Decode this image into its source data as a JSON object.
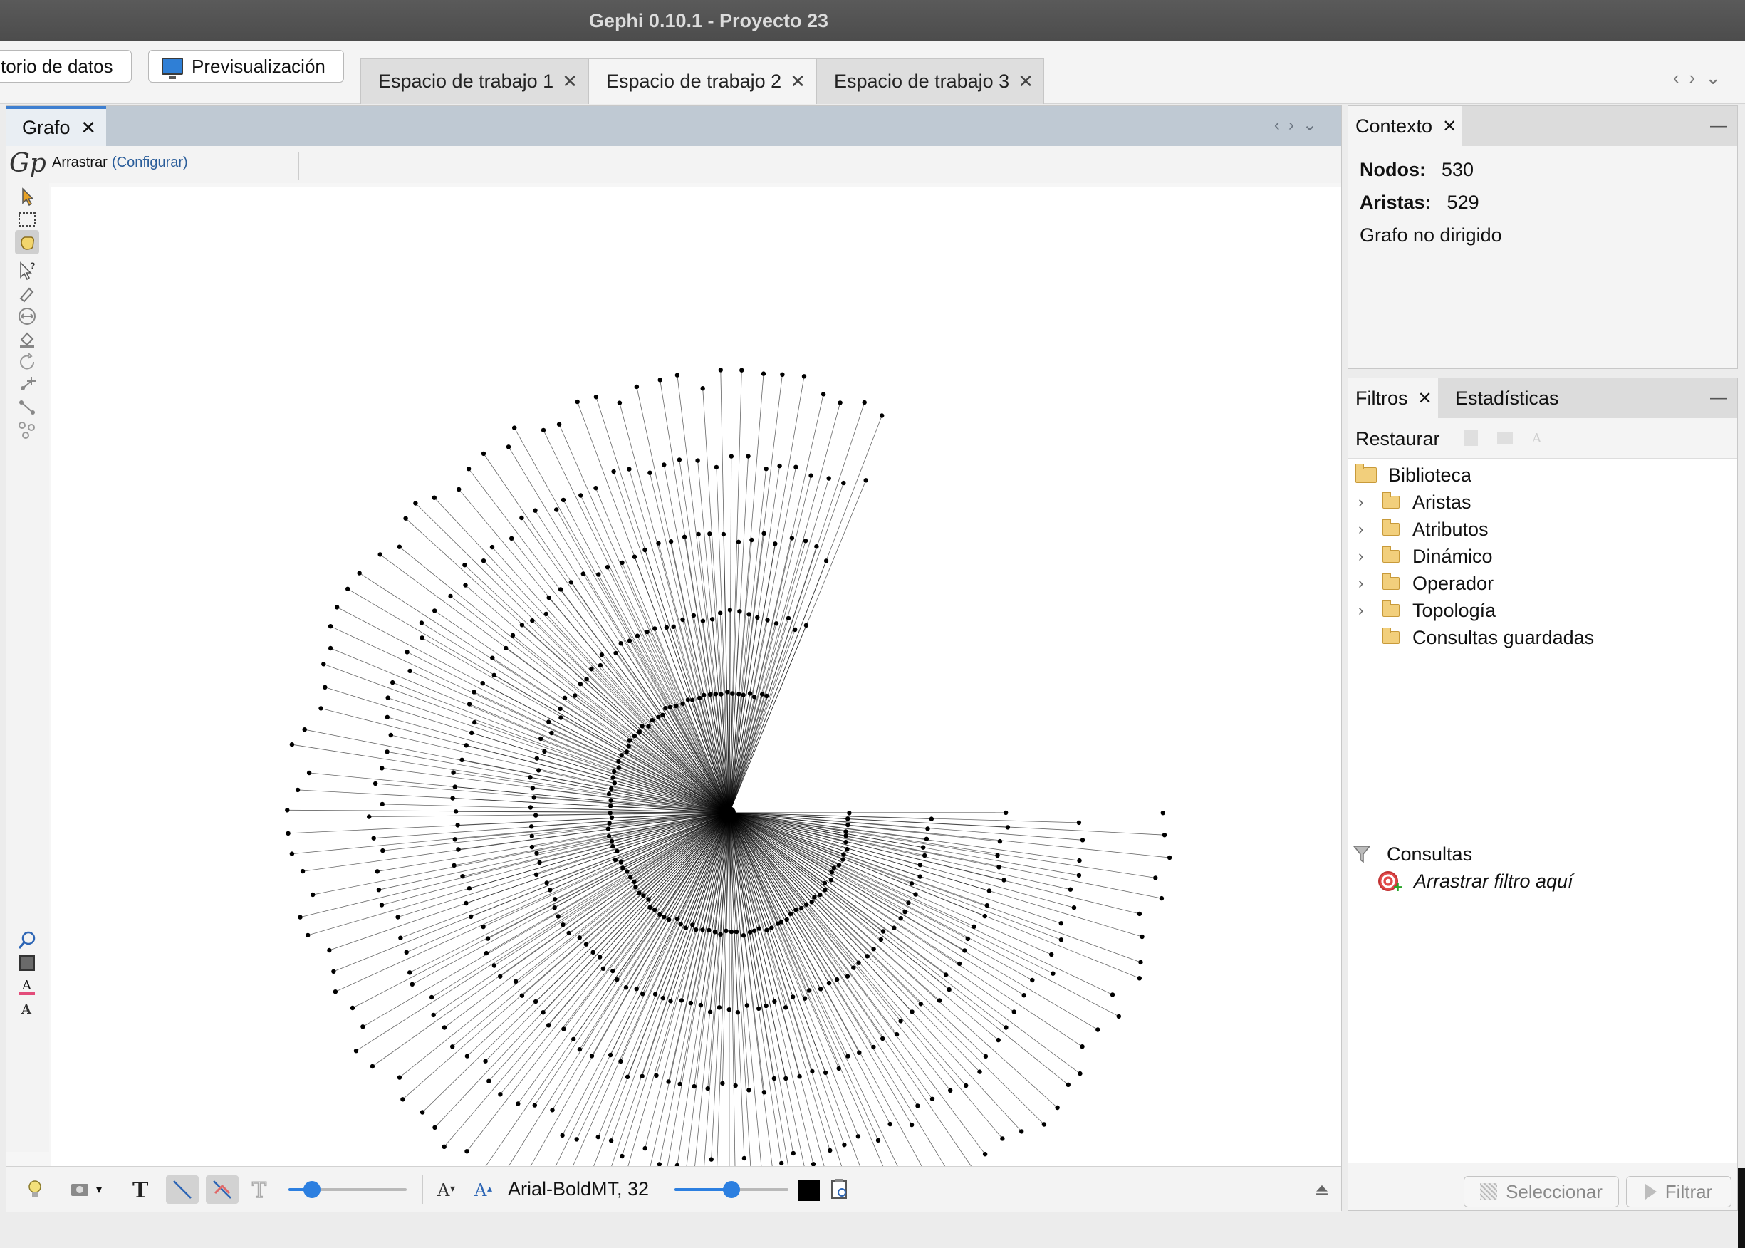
{
  "window": {
    "title": "Gephi 0.10.1 - Proyecto 23"
  },
  "topbar": {
    "data_lab_label": "torio de datos",
    "preview_label": "Previsualización",
    "workspaces": [
      {
        "label": "Espacio de trabajo 1",
        "active": false
      },
      {
        "label": "Espacio de trabajo 2",
        "active": true
      },
      {
        "label": "Espacio de trabajo 3",
        "active": false
      }
    ],
    "close_glyph": "✕"
  },
  "graph": {
    "tab_label": "Grafo",
    "mode_label": "Arrastrar",
    "configure_label": "(Configurar)",
    "logo_text": "Gp",
    "network": {
      "layout": "radial star",
      "central_hub": 1,
      "leaf_nodes": 529,
      "edge_color": "#000000",
      "node_color": "#000000"
    },
    "bottom": {
      "font_label": "Arial-BoldMT, 32",
      "edge_scale_value": 0.2,
      "label_size_value": 0.5,
      "label_color": "#000000"
    }
  },
  "context": {
    "tab_label": "Contexto",
    "nodes_label": "Nodos:",
    "nodes_value": "530",
    "edges_label": "Aristas:",
    "edges_value": "529",
    "graph_type": "Grafo no dirigido"
  },
  "filters": {
    "tab_label": "Filtros",
    "stats_tab_label": "Estadísticas",
    "reset_label": "Restaurar",
    "library_label": "Biblioteca",
    "library_items": [
      {
        "label": "Aristas",
        "expandable": true
      },
      {
        "label": "Atributos",
        "expandable": true
      },
      {
        "label": "Dinámico",
        "expandable": true
      },
      {
        "label": "Operador",
        "expandable": true
      },
      {
        "label": "Topología",
        "expandable": true
      },
      {
        "label": "Consultas guardadas",
        "expandable": false
      }
    ],
    "queries_label": "Consultas",
    "drop_hint": "Arrastrar filtro aquí",
    "select_label": "Seleccionar",
    "filter_label": "Filtrar"
  },
  "colors": {
    "accent": "#2c7fe0",
    "link": "#2a5d9a",
    "tab_active_border": "#3e7fd0"
  }
}
